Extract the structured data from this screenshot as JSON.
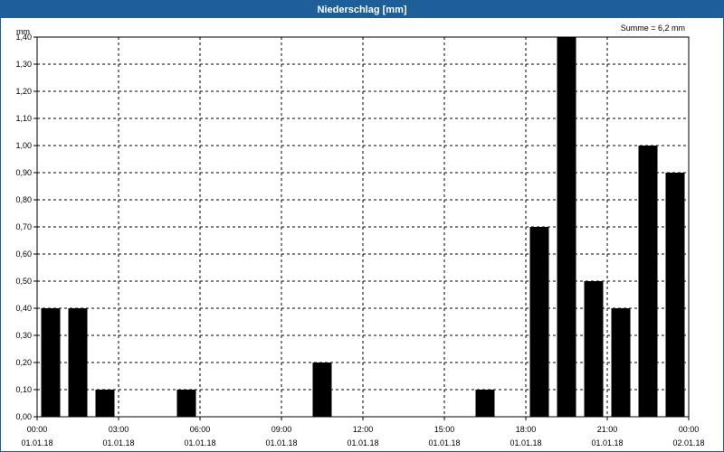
{
  "window": {
    "title": "Niederschlag [mm]"
  },
  "chart_data": {
    "type": "bar",
    "title": "Niederschlag [mm]",
    "ylabel": "mm",
    "ylim": [
      0,
      1.4
    ],
    "y_ticks": [
      "0,00",
      "0,10",
      "0,20",
      "0,30",
      "0,40",
      "0,50",
      "0,60",
      "0,70",
      "0,80",
      "0,90",
      "1,00",
      "1,10",
      "1,20",
      "1,30",
      "1,40"
    ],
    "x_ticks": [
      {
        "time": "00:00",
        "date": "01.01.18"
      },
      {
        "time": "03:00",
        "date": "01.01.18"
      },
      {
        "time": "06:00",
        "date": "01.01.18"
      },
      {
        "time": "09:00",
        "date": "01.01.18"
      },
      {
        "time": "12:00",
        "date": "01.01.18"
      },
      {
        "time": "15:00",
        "date": "01.01.18"
      },
      {
        "time": "18:00",
        "date": "01.01.18"
      },
      {
        "time": "21:00",
        "date": "01.01.18"
      },
      {
        "time": "00:00",
        "date": "02.01.18"
      }
    ],
    "x_range": [
      "01.01.18 00:00",
      "02.01.18 00:00"
    ],
    "grid": true,
    "annotation": "Summe = 6,2 mm",
    "categories": [
      "00:00",
      "01:00",
      "02:00",
      "03:00",
      "04:00",
      "05:00",
      "06:00",
      "07:00",
      "08:00",
      "09:00",
      "10:00",
      "11:00",
      "12:00",
      "13:00",
      "14:00",
      "15:00",
      "16:00",
      "17:00",
      "18:00",
      "19:00",
      "20:00",
      "21:00",
      "22:00",
      "23:00"
    ],
    "values": [
      0.4,
      0.4,
      0.1,
      0,
      0,
      0.1,
      0,
      0,
      0,
      0,
      0.2,
      0,
      0,
      0,
      0,
      0,
      0.1,
      0,
      0.7,
      1.4,
      0.5,
      0.4,
      1.0,
      0.9
    ],
    "bar_color": "#000000"
  }
}
